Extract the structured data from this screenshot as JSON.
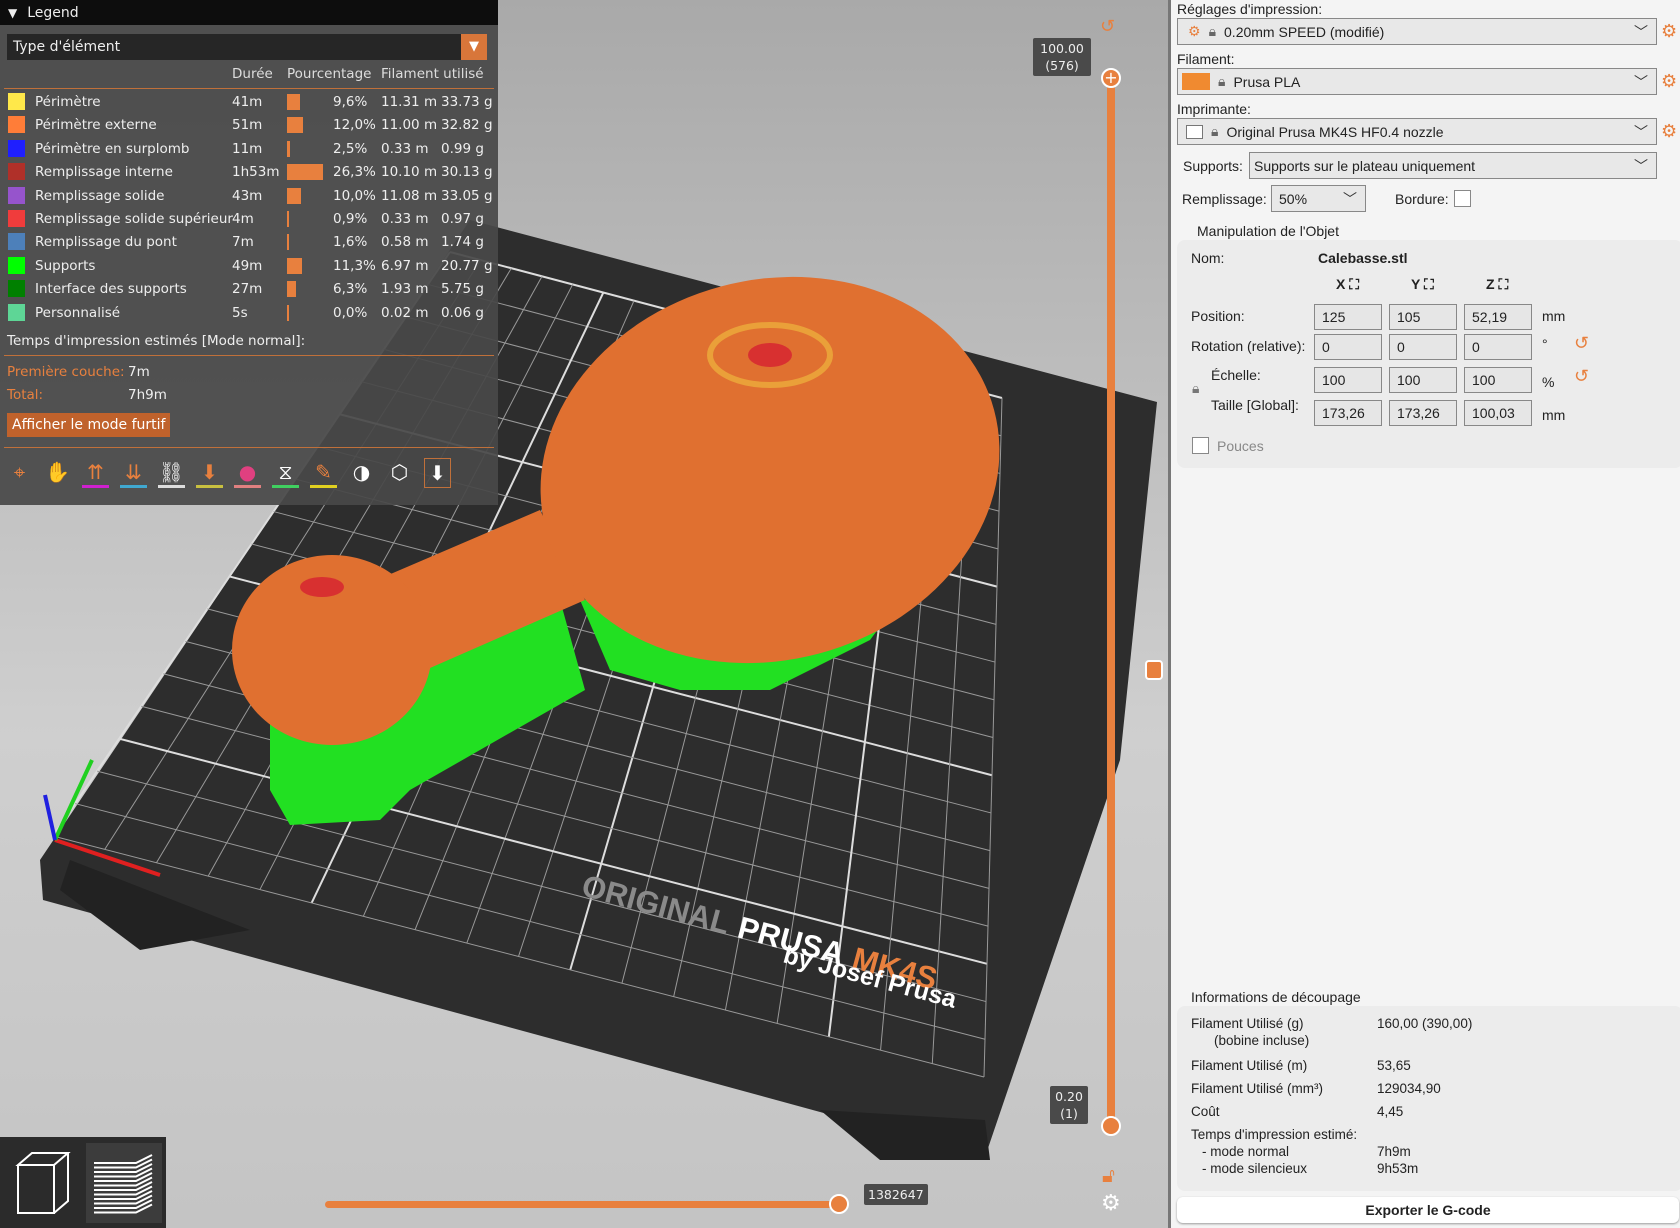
{
  "legend": {
    "title": "Legend",
    "view_type": "Type d'élément",
    "columns": [
      "Durée",
      "Pourcentage",
      "Filament utilisé"
    ],
    "rows": [
      {
        "label": "Périmètre",
        "color": "#ffe84a",
        "time": "41m",
        "percent": "9,6%",
        "pct": 9.6,
        "length": "11.31 m",
        "weight": "33.73 g"
      },
      {
        "label": "Périmètre externe",
        "color": "#ff7d38",
        "time": "51m",
        "percent": "12,0%",
        "pct": 12.0,
        "length": "11.00 m",
        "weight": "32.82 g"
      },
      {
        "label": "Périmètre en surplomb",
        "color": "#1f1fff",
        "time": "11m",
        "percent": "2,5%",
        "pct": 2.5,
        "length": "0.33 m",
        "weight": "0.99 g"
      },
      {
        "label": "Remplissage interne",
        "color": "#b03029",
        "time": "1h53m",
        "percent": "26,3%",
        "pct": 26.3,
        "length": "10.10 m",
        "weight": "30.13 g"
      },
      {
        "label": "Remplissage solide",
        "color": "#9654cc",
        "time": "43m",
        "percent": "10,0%",
        "pct": 10.0,
        "length": "11.08 m",
        "weight": "33.05 g"
      },
      {
        "label": "Remplissage solide supérieur",
        "color": "#f03c3c",
        "time": "4m",
        "percent": "0,9%",
        "pct": 0.9,
        "length": "0.33 m",
        "weight": "0.97 g"
      },
      {
        "label": "Remplissage du pont",
        "color": "#4d80ba",
        "time": "7m",
        "percent": "1,6%",
        "pct": 1.6,
        "length": "0.58 m",
        "weight": "1.74 g"
      },
      {
        "label": "Supports",
        "color": "#00ff00",
        "time": "49m",
        "percent": "11,3%",
        "pct": 11.3,
        "length": "6.97 m",
        "weight": "20.77 g"
      },
      {
        "label": "Interface des supports",
        "color": "#008000",
        "time": "27m",
        "percent": "6,3%",
        "pct": 6.3,
        "length": "1.93 m",
        "weight": "5.75 g"
      },
      {
        "label": "Personnalisé",
        "color": "#5ed696",
        "time": "5s",
        "percent": "0,0%",
        "pct": 0.0,
        "length": "0.02 m",
        "weight": "0.06 g"
      }
    ],
    "estimate_title": "Temps d'impression estimés [Mode normal]:",
    "first_layer_label": "Première couche:",
    "first_layer": "7m",
    "total_label": "Total:",
    "total": "7h9m",
    "stealth_button": "Afficher le mode furtif",
    "tools": [
      "travel-icon",
      "wipe-icon",
      "retractions-icon",
      "deretractions-icon",
      "seams-icon",
      "tool-changes-icon",
      "color-changes-icon",
      "pause-icon",
      "custom-gcode-icon",
      "center-of-gravity-icon",
      "shells-icon",
      "tool-marker-icon"
    ]
  },
  "viewport": {
    "bed_brand": "ORIGINAL",
    "bed_prusa": "PRUSA",
    "bed_model": "MK4S",
    "bed_by": "by Josef Prusa",
    "top_layer": "100.00",
    "top_layer_index": "(576)",
    "bottom_layer": "0.20",
    "bottom_layer_index": "(1)",
    "move_index": "1382647",
    "accent": "#e8803e"
  },
  "panel": {
    "print_settings_label": "Réglages d'impression:",
    "print_settings": "0.20mm SPEED (modifié)",
    "filament_label": "Filament:",
    "filament": "Prusa PLA",
    "filament_color": "#f08a30",
    "printer_label": "Imprimante:",
    "printer": "Original Prusa MK4S HF0.4 nozzle",
    "supports_label": "Supports:",
    "supports": "Supports sur le plateau uniquement",
    "infill_label": "Remplissage:",
    "infill": "50%",
    "brim_label": "Bordure:",
    "brim_checked": false,
    "object": {
      "title": "Manipulation de l'Objet",
      "name_label": "Nom:",
      "name": "Calebasse.stl",
      "axes": [
        "X",
        "Y",
        "Z"
      ],
      "position_label": "Position:",
      "position": [
        "125",
        "105",
        "52,19"
      ],
      "position_unit": "mm",
      "rotation_label": "Rotation (relative):",
      "rotation": [
        "0",
        "0",
        "0"
      ],
      "rotation_unit": "°",
      "scale_label": "Échelle:",
      "scale": [
        "100",
        "100",
        "100"
      ],
      "scale_unit": "%",
      "size_label": "Taille [Global]:",
      "size": [
        "173,26",
        "173,26",
        "100,03"
      ],
      "size_unit": "mm",
      "inches_label": "Pouces",
      "inches_checked": false
    },
    "slice_info": {
      "title": "Informations de découpage",
      "items": [
        {
          "label": "Filament Utilisé (g)",
          "sub": "(bobine incluse)",
          "value": "160,00 (390,00)"
        },
        {
          "label": "Filament Utilisé (m)",
          "value": "53,65"
        },
        {
          "label": "Filament Utilisé (mm³)",
          "value": "129034,90"
        },
        {
          "label": "Coût",
          "value": "4,45"
        }
      ],
      "time_label": "Temps d'impression estimé:",
      "normal_label": "- mode normal",
      "normal": "7h9m",
      "silent_label": "- mode silencieux",
      "silent": "9h53m"
    },
    "export_button": "Exporter le G-code"
  }
}
